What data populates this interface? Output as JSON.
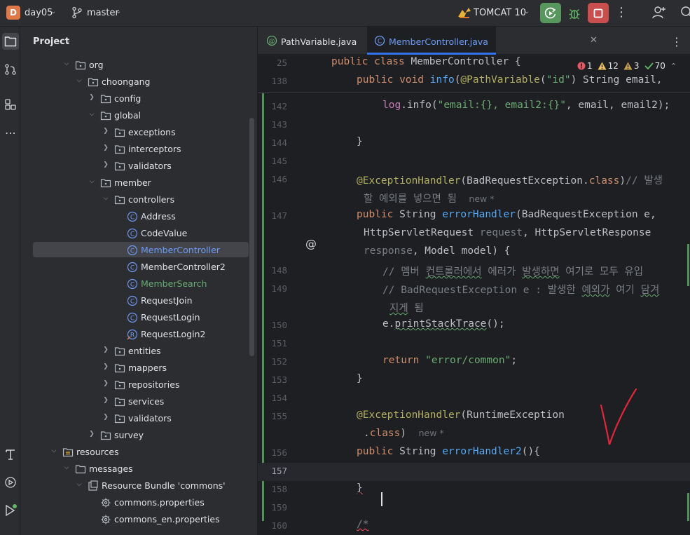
{
  "titlebar": {
    "project_badge": "D",
    "project_name": "day05",
    "branch_name": "master",
    "run_config": "TOMCAT 10",
    "icons": {
      "branch": "git-branch-icon",
      "run": "run-icon",
      "debug": "debug-icon",
      "stop": "stop-icon",
      "more": "more-vertical-icon",
      "add_user": "add-user-icon",
      "search": "search-icon"
    },
    "colors": {
      "run_bg": "#57965c",
      "stop_bg": "#c94f4f",
      "project_badge_bg": "#e0784a"
    }
  },
  "activitybar": {
    "items": [
      "project-icon",
      "commit-icon",
      "structure-icon",
      "more-horizontal-icon",
      "build-icon",
      "services-icon",
      "run-icon"
    ]
  },
  "project_panel": {
    "title": "Project",
    "tree": [
      {
        "label": "org",
        "type": "package",
        "expanded": true
      },
      {
        "label": "choongang",
        "type": "package",
        "expanded": true
      },
      {
        "label": "config",
        "type": "package",
        "expanded": false
      },
      {
        "label": "global",
        "type": "package",
        "expanded": true
      },
      {
        "label": "exceptions",
        "type": "package",
        "expanded": false
      },
      {
        "label": "interceptors",
        "type": "package",
        "expanded": false
      },
      {
        "label": "validators",
        "type": "package",
        "expanded": false
      },
      {
        "label": "member",
        "type": "package",
        "expanded": true
      },
      {
        "label": "controllers",
        "type": "package",
        "expanded": true
      },
      {
        "label": "Address",
        "type": "class"
      },
      {
        "label": "CodeValue",
        "type": "class"
      },
      {
        "label": "MemberController",
        "type": "class",
        "selected": true
      },
      {
        "label": "MemberController2",
        "type": "class"
      },
      {
        "label": "MemberSearch",
        "type": "class"
      },
      {
        "label": "RequestJoin",
        "type": "class"
      },
      {
        "label": "RequestLogin",
        "type": "class"
      },
      {
        "label": "RequestLogin2",
        "type": "record"
      },
      {
        "label": "entities",
        "type": "package",
        "expanded": false
      },
      {
        "label": "mappers",
        "type": "package",
        "expanded": false
      },
      {
        "label": "repositories",
        "type": "package",
        "expanded": false
      },
      {
        "label": "services",
        "type": "package",
        "expanded": false
      },
      {
        "label": "validators",
        "type": "package",
        "expanded": false
      },
      {
        "label": "survey",
        "type": "package",
        "expanded": false
      },
      {
        "label": "resources",
        "type": "resources",
        "expanded": true
      },
      {
        "label": "messages",
        "type": "folder",
        "expanded": true
      },
      {
        "label": "Resource Bundle 'commons'",
        "type": "bundle",
        "expanded": true
      },
      {
        "label": "commons.properties",
        "type": "properties"
      },
      {
        "label": "commons_en.properties",
        "type": "properties"
      }
    ]
  },
  "editor": {
    "tabs": [
      {
        "label": "PathVariable.java",
        "active": false
      },
      {
        "label": "MemberController.java",
        "active": true
      }
    ],
    "inspections": {
      "errors": "1",
      "warnings": "12",
      "weak_warnings": "3",
      "ok": "70"
    },
    "sticky": [
      {
        "ln": "25",
        "text": "public class MemberController {"
      },
      {
        "ln": "138",
        "text": "public void info(@PathVariable(\"id\") String email,"
      }
    ],
    "lines": [
      {
        "ln": "142",
        "text": "log.info(\"email:{}, email2:{}\", email, email2);"
      },
      {
        "ln": "143",
        "text": ""
      },
      {
        "ln": "144",
        "text": "}"
      },
      {
        "ln": "145",
        "text": ""
      },
      {
        "ln": "146",
        "text": "@ExceptionHandler(BadRequestException.class)// 발생"
      },
      {
        "ln": "",
        "text": "할 예외를 넣으면 됨"
      },
      {
        "ln": "147",
        "text": "public String errorHandler(BadRequestException e,"
      },
      {
        "ln": "",
        "text": "HttpServletRequest request, HttpServletResponse"
      },
      {
        "ln": "",
        "text": "response, Model model) {"
      },
      {
        "ln": "148",
        "text": "// 멤버 컨트롤러에서 에러가 발생하면 여기로 모두 유입"
      },
      {
        "ln": "149",
        "text": "// BadRequestException e : 발생한 예외가 여기 담겨"
      },
      {
        "ln": "",
        "text": "지게 됨"
      },
      {
        "ln": "150",
        "text": "e.printStackTrace();"
      },
      {
        "ln": "151",
        "text": ""
      },
      {
        "ln": "152",
        "text": "return \"error/common\";"
      },
      {
        "ln": "153",
        "text": "}"
      },
      {
        "ln": "154",
        "text": ""
      },
      {
        "ln": "155",
        "text": "@ExceptionHandler(RuntimeException"
      },
      {
        "ln": "",
        "text": ".class)"
      },
      {
        "ln": "156",
        "text": "public String errorHandler2(){"
      },
      {
        "ln": "157",
        "text": ""
      },
      {
        "ln": "158",
        "text": "}"
      },
      {
        "ln": "159",
        "text": ""
      },
      {
        "ln": "160",
        "text": "/*"
      }
    ],
    "inlay_new": "new *",
    "colors": {
      "keyword": "#cf8e6d",
      "function": "#56a8f5",
      "string": "#6aab73",
      "annotation": "#b3ae60",
      "comment": "#7a7e85",
      "accent": "#3574f0"
    }
  }
}
